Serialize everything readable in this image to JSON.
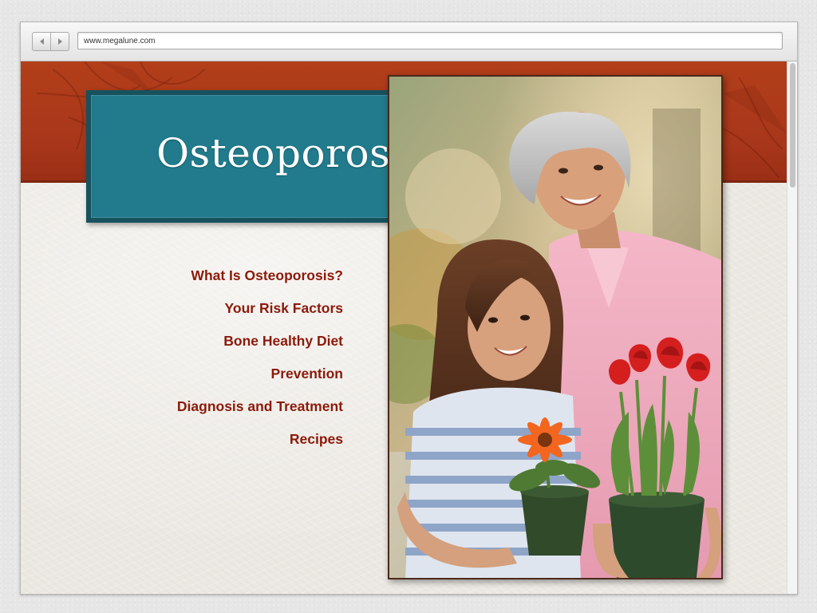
{
  "browser": {
    "url": "www.megalune.com",
    "back_icon": "back-arrow-icon",
    "forward_icon": "forward-arrow-icon"
  },
  "page": {
    "title": "Osteoporosis",
    "menu": [
      {
        "label": "What Is Osteoporosis?"
      },
      {
        "label": "Your Risk Factors"
      },
      {
        "label": "Bone Healthy Diet"
      },
      {
        "label": "Prevention"
      },
      {
        "label": "Diagnosis and Treatment"
      },
      {
        "label": "Recipes"
      }
    ],
    "hero_image": "grandmother-and-granddaughter-holding-potted-flowers"
  },
  "colors": {
    "banner": "#a8361a",
    "title_box": "#217b8c",
    "title_box_border": "#17515d",
    "menu_link": "#8b1a0a",
    "page_background": "#ece9e3"
  }
}
